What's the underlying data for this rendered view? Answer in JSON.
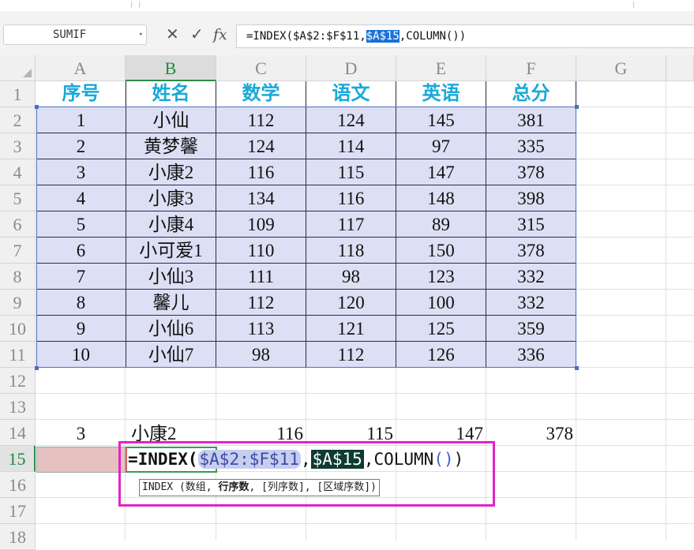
{
  "formula_bar": {
    "name_box": "SUMIF",
    "name_box_arrow": "▾",
    "cancel_glyph": "✕",
    "enter_glyph": "✓",
    "fx_label": "fx",
    "formula_part1": "=INDEX($A$2:$F$11,",
    "formula_highlight": "$A$15",
    "formula_part2": ",COLUMN())"
  },
  "columns": [
    "A",
    "B",
    "C",
    "D",
    "E",
    "F",
    "G"
  ],
  "rows": [
    "1",
    "2",
    "3",
    "4",
    "5",
    "6",
    "7",
    "8",
    "9",
    "10",
    "11",
    "12",
    "13",
    "14",
    "15",
    "16",
    "17",
    "18"
  ],
  "table": {
    "headers": [
      "序号",
      "姓名",
      "数学",
      "语文",
      "英语",
      "总分"
    ],
    "rows": [
      [
        "1",
        "小仙",
        "112",
        "124",
        "145",
        "381"
      ],
      [
        "2",
        "黄梦馨",
        "124",
        "114",
        "97",
        "335"
      ],
      [
        "3",
        "小康2",
        "116",
        "115",
        "147",
        "378"
      ],
      [
        "4",
        "小康3",
        "134",
        "116",
        "148",
        "398"
      ],
      [
        "5",
        "小康4",
        "109",
        "117",
        "89",
        "315"
      ],
      [
        "6",
        "小可爱1",
        "110",
        "118",
        "150",
        "378"
      ],
      [
        "7",
        "小仙3",
        "111",
        "98",
        "123",
        "332"
      ],
      [
        "8",
        "馨儿",
        "112",
        "120",
        "100",
        "332"
      ],
      [
        "9",
        "小仙6",
        "113",
        "121",
        "125",
        "359"
      ],
      [
        "10",
        "小仙7",
        "98",
        "112",
        "126",
        "336"
      ]
    ]
  },
  "row14": {
    "a": "3",
    "b": "小康2",
    "c": "116",
    "d": "115",
    "e": "147",
    "f": "378"
  },
  "edit": {
    "fn": "=INDEX(",
    "ref1": "$A$2:$F$11",
    "comma1": ",",
    "ref2": "$A$15",
    "rest": ",COLUMN",
    "parens": "()",
    "close": ")"
  },
  "tooltip": {
    "pre": "INDEX (数组, ",
    "current": "行序数",
    "post": ", [列序数], [区域序数])"
  }
}
